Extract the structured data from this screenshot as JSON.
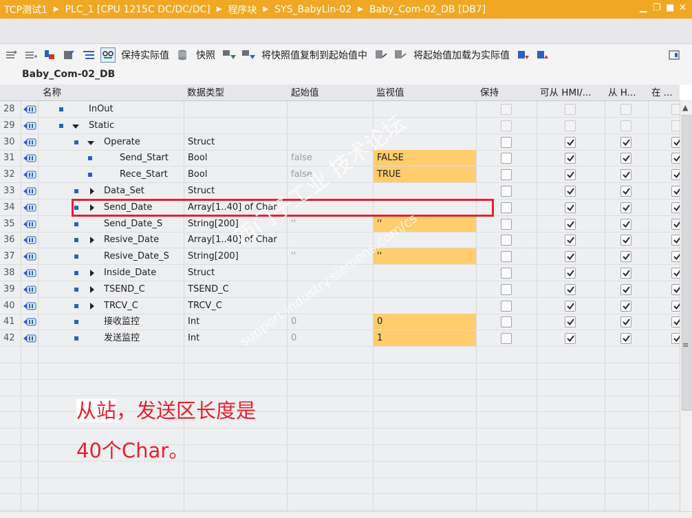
{
  "titlebar": {
    "crumbs": [
      "TCP测试1",
      "PLC_1 [CPU 1215C DC/DC/DC]",
      "程序块",
      "SYS_BabyLin-02",
      "Baby_Com-02_DB [DB7]"
    ],
    "bg_color": "#f0a824"
  },
  "toolbar": {
    "keep_actual": "保持实际值",
    "snapshot": "快照",
    "copy_snapshot": "将快照值复制到起始值中",
    "load_start": "将起始值加载为实际值"
  },
  "db_title": "Baby_Com-02_DB",
  "columns": {
    "name": "名称",
    "datatype": "数据类型",
    "start": "起始值",
    "monitor": "监视值",
    "retain": "保持",
    "hmi": "可从 HMI/...",
    "from_h": "从 H...",
    "in": "在 ..."
  },
  "rows": [
    {
      "num": "28",
      "name": "InOut",
      "type": "",
      "start": "",
      "monitor": "",
      "checks": "dis"
    },
    {
      "num": "29",
      "name": "Static",
      "type": "",
      "start": "",
      "monitor": "",
      "checks": "dis"
    },
    {
      "num": "30",
      "name": "Operate",
      "type": "Struct",
      "start": "",
      "monitor": "",
      "checks": "on"
    },
    {
      "num": "31",
      "name": "Send_Start",
      "type": "Bool",
      "start": "false",
      "monitor": "FALSE",
      "checks": "on"
    },
    {
      "num": "32",
      "name": "Rece_Start",
      "type": "Bool",
      "start": "false",
      "monitor": "TRUE",
      "checks": "on"
    },
    {
      "num": "33",
      "name": "Data_Set",
      "type": "Struct",
      "start": "",
      "monitor": "",
      "checks": "on"
    },
    {
      "num": "34",
      "name": "Send_Date",
      "type": "Array[1..40] of Char",
      "start": "",
      "monitor": "",
      "checks": "on"
    },
    {
      "num": "35",
      "name": "Send_Date_S",
      "type": "String[200]",
      "start": "''",
      "monitor": "''",
      "checks": "on"
    },
    {
      "num": "36",
      "name": "Resive_Date",
      "type": "Array[1..40] of Char",
      "start": "",
      "monitor": "",
      "checks": "on"
    },
    {
      "num": "37",
      "name": "Resive_Date_S",
      "type": "String[200]",
      "start": "''",
      "monitor": "''",
      "checks": "on"
    },
    {
      "num": "38",
      "name": "Inside_Date",
      "type": "Struct",
      "start": "",
      "monitor": "",
      "checks": "on"
    },
    {
      "num": "39",
      "name": "TSEND_C",
      "type": "TSEND_C",
      "start": "",
      "monitor": "",
      "checks": "on"
    },
    {
      "num": "40",
      "name": "TRCV_C",
      "type": "TRCV_C",
      "start": "",
      "monitor": "",
      "checks": "on"
    },
    {
      "num": "41",
      "name": "接收监控",
      "type": "Int",
      "start": "0",
      "monitor": "0",
      "checks": "on"
    },
    {
      "num": "42",
      "name": "发送监控",
      "type": "Int",
      "start": "0",
      "monitor": "1",
      "checks": "on"
    }
  ],
  "annotation": {
    "line1_highlight": "从站",
    "line1_rest": "，发送区长度是",
    "line2": "40个Char。",
    "color": "#e8202a"
  },
  "watermark": {
    "line1": "西门子工业  技术论坛",
    "line2": "support.industry.siemens.com/cs"
  },
  "monitor_highlight_color": "#ffcd6e"
}
